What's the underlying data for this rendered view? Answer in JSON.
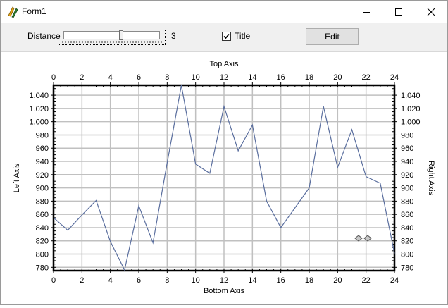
{
  "window": {
    "title": "Form1",
    "icon": "app-icon"
  },
  "toolbar": {
    "distance_label": "Distance",
    "distance_value": "3",
    "distance_fraction": 0.6,
    "title_checkbox_label": "Title",
    "title_checked": true,
    "edit_label": "Edit"
  },
  "chart_data": {
    "type": "line",
    "x_top_label": "Top Axis",
    "x_bottom_label": "Bottom Axis",
    "y_left_label": "Left Axis",
    "y_right_label": "Right Axis",
    "xlim": [
      0,
      24
    ],
    "ylim": [
      775,
      1055
    ],
    "x_ticks": [
      0,
      2,
      4,
      6,
      8,
      10,
      12,
      14,
      16,
      18,
      20,
      22,
      24
    ],
    "y_ticks": [
      780,
      800,
      820,
      840,
      860,
      880,
      900,
      920,
      940,
      960,
      980,
      1000,
      1020,
      1040
    ],
    "y_tick_labels": [
      "780",
      "800",
      "820",
      "840",
      "860",
      "880",
      "900",
      "920",
      "940",
      "960",
      "980",
      "1.000",
      "1.020",
      "1.040"
    ],
    "grid": true,
    "line_color": "#5a6e9e",
    "series": [
      {
        "x": [
          0,
          1,
          2,
          3,
          4,
          5,
          6,
          7,
          8,
          9,
          10,
          11,
          12,
          13,
          14,
          15,
          16,
          17,
          18,
          19,
          20,
          21,
          22,
          23,
          24
        ],
        "y": [
          855,
          836,
          859,
          881,
          819,
          776,
          873,
          817,
          938,
          1055,
          936,
          922,
          1023,
          956,
          995,
          880,
          840,
          870,
          900,
          1023,
          931,
          988,
          917,
          907,
          801
        ]
      }
    ]
  }
}
